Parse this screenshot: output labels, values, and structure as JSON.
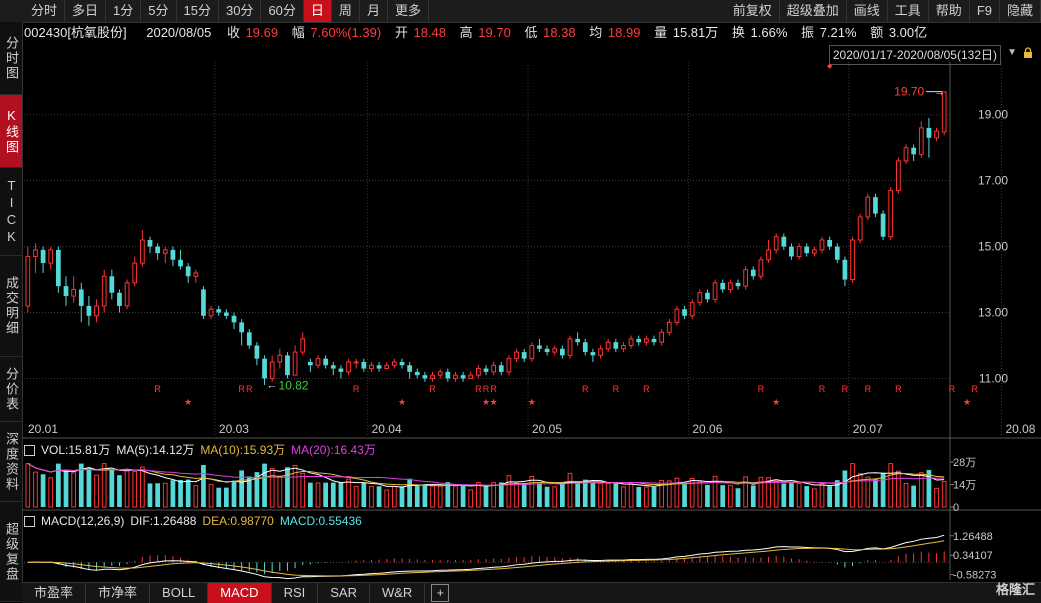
{
  "toolbar": {
    "left": [
      "分时",
      "多日",
      "1分",
      "5分",
      "15分",
      "30分",
      "60分",
      "日",
      "周",
      "月",
      "更多"
    ],
    "active": "日",
    "right": [
      "前复权",
      "超级叠加",
      "画线",
      "工具",
      "帮助",
      "F9",
      "隐藏"
    ]
  },
  "leftnav": [
    {
      "label": "分时图",
      "active": false
    },
    {
      "label": "K线图",
      "active": true
    },
    {
      "label": "TICK",
      "active": false
    },
    {
      "label": "成交明细",
      "active": false
    },
    {
      "label": "分价表",
      "active": false
    },
    {
      "label": "深度资料",
      "active": false
    },
    {
      "label": "超级复盘",
      "active": false
    }
  ],
  "info": {
    "code_name": "002430[杭氧股份]",
    "date": "2020/08/05",
    "close_label": "收",
    "close": "19.69",
    "change_label": "幅",
    "change": "7.60%(1.39)",
    "open_label": "开",
    "open": "18.48",
    "high_label": "高",
    "high": "19.70",
    "low_label": "低",
    "low": "18.38",
    "avg_label": "均",
    "avg": "18.99",
    "volume_label": "量",
    "volume": "15.81万",
    "turnover_label": "换",
    "turnover": "1.66%",
    "amplitude_label": "振",
    "amplitude": "7.21%",
    "amount_label": "额",
    "amount": "3.00亿"
  },
  "range_label": "2020/01/17-2020/08/05(132日)",
  "vol_panel": {
    "vol": "VOL:15.81万",
    "ma5": "MA(5):14.12万",
    "ma10": "MA(10):15.93万",
    "ma20": "MA(20):16.43万"
  },
  "macd_panel": {
    "name": "MACD(12,26,9)",
    "dif": "DIF:1.26488",
    "dea": "DEA:0.98770",
    "macd": "MACD:0.55436"
  },
  "bottom_tabs": [
    "市盈率",
    "市净率",
    "BOLL",
    "MACD",
    "RSI",
    "SAR",
    "W&R"
  ],
  "bottom_active": "MACD",
  "watermark": "格隆汇",
  "colors": {
    "up": "#ff3232",
    "down": "#54d8d8",
    "ma5": "#ffffff",
    "ma10": "#e8b93a",
    "ma20": "#e040e0",
    "grid": "#3a3a3a",
    "axis": "#c9c9c9",
    "dif": "#ffffff",
    "dea": "#e8b93a"
  },
  "chart_data": {
    "type": "candlestick",
    "price_axis": {
      "ticks": [
        "19.00",
        "17.00",
        "15.00",
        "13.00",
        "11.00"
      ],
      "ylim": [
        9.8,
        20.6
      ]
    },
    "date_labels": [
      "20.01",
      "20.03",
      "20.04",
      "20.05",
      "20.06",
      "20.07",
      "20.08"
    ],
    "annotations": {
      "high": "19.70",
      "low": "10.82",
      "high_marker": "↓"
    },
    "candles": [
      [
        13.2,
        14.7,
        15.0,
        13.0
      ],
      [
        14.7,
        14.9,
        15.1,
        14.2
      ],
      [
        14.9,
        14.5,
        15.0,
        14.2
      ],
      [
        14.5,
        14.9,
        15.0,
        14.3
      ],
      [
        14.9,
        13.8,
        15.0,
        13.6
      ],
      [
        13.8,
        13.5,
        14.1,
        13.2
      ],
      [
        13.5,
        13.7,
        14.1,
        13.3
      ],
      [
        13.7,
        13.2,
        13.9,
        12.7
      ],
      [
        13.2,
        12.9,
        13.5,
        12.6
      ],
      [
        12.9,
        13.2,
        13.4,
        12.7
      ],
      [
        13.2,
        14.1,
        14.3,
        13.0
      ],
      [
        14.1,
        13.6,
        14.3,
        13.4
      ],
      [
        13.6,
        13.2,
        13.7,
        13.0
      ],
      [
        13.2,
        13.9,
        14.0,
        13.1
      ],
      [
        13.9,
        14.5,
        14.7,
        13.8
      ],
      [
        14.5,
        15.2,
        15.5,
        14.4
      ],
      [
        15.2,
        15.0,
        15.3,
        14.8
      ],
      [
        15.0,
        14.8,
        15.1,
        14.6
      ],
      [
        14.8,
        14.9,
        15.0,
        14.5
      ],
      [
        14.9,
        14.6,
        15.0,
        14.4
      ],
      [
        14.6,
        14.4,
        14.9,
        14.3
      ],
      [
        14.4,
        14.1,
        14.5,
        13.9
      ],
      [
        14.1,
        14.2,
        14.3,
        13.9
      ],
      [
        13.7,
        12.9,
        13.8,
        12.8
      ],
      [
        12.9,
        13.1,
        13.2,
        12.8
      ],
      [
        13.1,
        13.0,
        13.2,
        12.9
      ],
      [
        13.0,
        12.9,
        13.1,
        12.8
      ],
      [
        12.9,
        12.7,
        13.0,
        12.5
      ],
      [
        12.7,
        12.4,
        12.8,
        12.0
      ],
      [
        12.4,
        12.0,
        12.5,
        11.9
      ],
      [
        12.0,
        11.6,
        12.1,
        11.4
      ],
      [
        11.6,
        11.0,
        11.7,
        10.8
      ],
      [
        11.0,
        11.5,
        11.7,
        10.9
      ],
      [
        11.5,
        11.7,
        11.9,
        11.3
      ],
      [
        11.7,
        11.1,
        11.8,
        11.0
      ],
      [
        11.1,
        11.8,
        12.0,
        11.1
      ],
      [
        11.8,
        12.2,
        12.4,
        11.7
      ],
      [
        11.5,
        11.4,
        11.6,
        11.2
      ],
      [
        11.4,
        11.6,
        11.7,
        11.3
      ],
      [
        11.6,
        11.4,
        11.7,
        11.3
      ],
      [
        11.4,
        11.3,
        11.5,
        11.1
      ],
      [
        11.3,
        11.2,
        11.4,
        11.0
      ],
      [
        11.2,
        11.5,
        11.6,
        11.1
      ],
      [
        11.5,
        11.5,
        11.6,
        11.3
      ],
      [
        11.5,
        11.3,
        11.6,
        11.2
      ],
      [
        11.3,
        11.4,
        11.5,
        11.2
      ],
      [
        11.4,
        11.3,
        11.5,
        11.2
      ],
      [
        11.3,
        11.4,
        11.5,
        11.3
      ],
      [
        11.4,
        11.5,
        11.6,
        11.3
      ],
      [
        11.5,
        11.4,
        11.6,
        11.3
      ],
      [
        11.4,
        11.2,
        11.5,
        11.0
      ],
      [
        11.2,
        11.1,
        11.3,
        11.0
      ],
      [
        11.1,
        11.0,
        11.2,
        10.9
      ],
      [
        11.0,
        11.1,
        11.2,
        10.9
      ],
      [
        11.1,
        11.2,
        11.3,
        11.0
      ],
      [
        11.2,
        11.0,
        11.3,
        10.9
      ],
      [
        11.0,
        11.1,
        11.2,
        10.9
      ],
      [
        11.1,
        11.0,
        11.2,
        10.9
      ],
      [
        11.0,
        11.1,
        11.2,
        11.0
      ],
      [
        11.1,
        11.3,
        11.4,
        11.0
      ],
      [
        11.3,
        11.2,
        11.4,
        11.1
      ],
      [
        11.2,
        11.4,
        11.5,
        11.1
      ],
      [
        11.4,
        11.2,
        11.5,
        11.1
      ],
      [
        11.2,
        11.6,
        11.7,
        11.1
      ],
      [
        11.6,
        11.8,
        11.9,
        11.5
      ],
      [
        11.8,
        11.6,
        11.9,
        11.5
      ],
      [
        11.6,
        12.0,
        12.1,
        11.5
      ],
      [
        12.0,
        11.9,
        12.2,
        11.8
      ],
      [
        11.9,
        11.8,
        12.0,
        11.7
      ],
      [
        11.8,
        11.9,
        12.0,
        11.7
      ],
      [
        11.9,
        11.7,
        12.0,
        11.6
      ],
      [
        11.7,
        12.2,
        12.3,
        11.6
      ],
      [
        12.2,
        12.1,
        12.4,
        12.0
      ],
      [
        12.1,
        11.8,
        12.2,
        11.7
      ],
      [
        11.8,
        11.7,
        11.9,
        11.5
      ],
      [
        11.7,
        11.9,
        12.0,
        11.6
      ],
      [
        11.9,
        12.1,
        12.2,
        11.8
      ],
      [
        12.1,
        11.9,
        12.2,
        11.8
      ],
      [
        11.9,
        12.0,
        12.1,
        11.8
      ],
      [
        12.0,
        12.2,
        12.3,
        11.9
      ],
      [
        12.2,
        12.1,
        12.3,
        12.0
      ],
      [
        12.1,
        12.2,
        12.3,
        12.0
      ],
      [
        12.2,
        12.1,
        12.3,
        12.0
      ],
      [
        12.1,
        12.4,
        12.5,
        12.0
      ],
      [
        12.4,
        12.7,
        12.8,
        12.3
      ],
      [
        12.7,
        13.1,
        13.2,
        12.6
      ],
      [
        13.1,
        12.9,
        13.2,
        12.8
      ],
      [
        12.9,
        13.3,
        13.4,
        12.8
      ],
      [
        13.3,
        13.6,
        13.7,
        13.2
      ],
      [
        13.6,
        13.4,
        13.7,
        13.3
      ],
      [
        13.4,
        13.9,
        14.0,
        13.3
      ],
      [
        13.9,
        13.7,
        14.0,
        13.6
      ],
      [
        13.7,
        13.9,
        14.0,
        13.6
      ],
      [
        13.9,
        13.8,
        14.0,
        13.7
      ],
      [
        13.8,
        14.3,
        14.4,
        13.7
      ],
      [
        14.3,
        14.1,
        14.4,
        14.0
      ],
      [
        14.1,
        14.6,
        14.7,
        14.0
      ],
      [
        14.6,
        14.9,
        15.2,
        14.5
      ],
      [
        14.9,
        15.3,
        15.4,
        14.8
      ],
      [
        15.3,
        15.0,
        15.4,
        14.9
      ],
      [
        15.0,
        14.7,
        15.1,
        14.6
      ],
      [
        14.7,
        15.0,
        15.1,
        14.6
      ],
      [
        15.0,
        14.8,
        15.1,
        14.7
      ],
      [
        14.8,
        14.9,
        15.0,
        14.7
      ],
      [
        14.9,
        15.2,
        15.3,
        14.8
      ],
      [
        15.2,
        15.0,
        15.3,
        14.9
      ],
      [
        15.0,
        14.6,
        15.1,
        14.5
      ],
      [
        14.6,
        14.0,
        14.7,
        13.8
      ],
      [
        14.0,
        15.2,
        15.3,
        13.9
      ],
      [
        15.2,
        15.9,
        16.0,
        15.1
      ],
      [
        15.9,
        16.5,
        16.6,
        15.8
      ],
      [
        16.5,
        16.0,
        16.6,
        15.9
      ],
      [
        16.0,
        15.3,
        16.1,
        15.2
      ],
      [
        15.3,
        16.7,
        16.8,
        15.2
      ],
      [
        16.7,
        17.6,
        17.7,
        16.6
      ],
      [
        17.6,
        18.0,
        18.1,
        17.5
      ],
      [
        18.0,
        17.8,
        18.1,
        17.6
      ],
      [
        17.8,
        18.6,
        18.8,
        17.7
      ],
      [
        18.6,
        18.3,
        18.9,
        17.7
      ],
      [
        18.3,
        18.5,
        18.6,
        18.2
      ],
      [
        18.48,
        19.69,
        19.7,
        18.38
      ]
    ],
    "volume_axis": {
      "ticks": [
        "28万",
        "14万",
        "0"
      ],
      "ymax": 28
    },
    "macd_axis": {
      "ticks": [
        "1.26488",
        "0.34107",
        "-0.58273"
      ],
      "ylim": [
        -0.65,
        1.35
      ]
    },
    "signals": {
      "R": [
        17,
        28,
        29,
        43,
        53,
        59,
        60,
        61,
        73,
        77,
        81,
        96,
        104,
        107,
        110,
        114,
        121,
        124
      ],
      "star": [
        21,
        49,
        60,
        61,
        66,
        98,
        123
      ],
      "diamond": [
        105
      ]
    }
  }
}
